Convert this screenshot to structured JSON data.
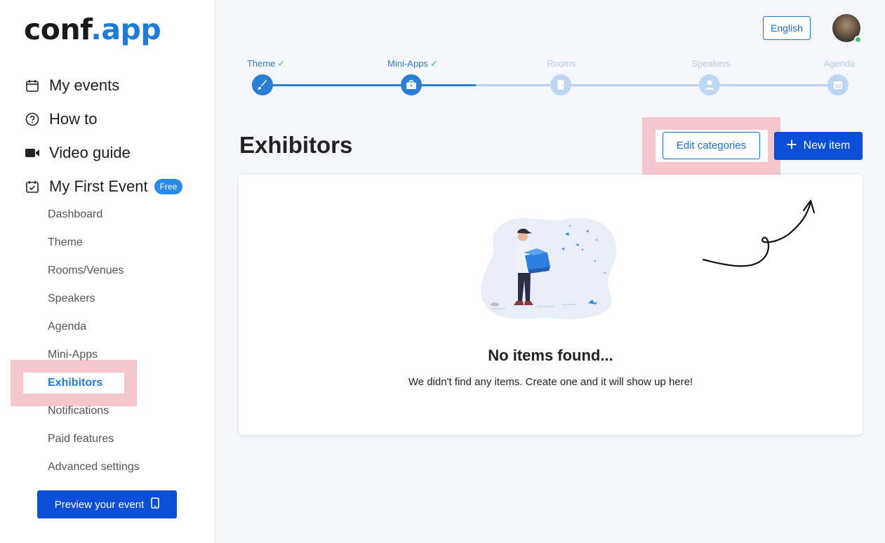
{
  "logo": {
    "main": "conf",
    "accent": ".app"
  },
  "sidebar": {
    "main_items": [
      {
        "label": "My events",
        "icon": "calendar-icon"
      },
      {
        "label": "How to",
        "icon": "question-circle-icon"
      },
      {
        "label": "Video guide",
        "icon": "video-camera-icon"
      },
      {
        "label": "My First Event",
        "icon": "calendar-check-icon",
        "badge": "Free"
      }
    ],
    "sub_items": [
      {
        "label": "Dashboard"
      },
      {
        "label": "Theme"
      },
      {
        "label": "Rooms/Venues"
      },
      {
        "label": "Speakers"
      },
      {
        "label": "Agenda"
      },
      {
        "label": "Mini-Apps"
      },
      {
        "label": "Exhibitors",
        "active": true
      },
      {
        "label": "Notifications"
      },
      {
        "label": "Paid features"
      },
      {
        "label": "Advanced settings"
      }
    ],
    "preview_label": "Preview your event"
  },
  "header": {
    "language": "English"
  },
  "stepper": {
    "steps": [
      {
        "label": "Theme",
        "done": true,
        "icon": "brush-icon"
      },
      {
        "label": "Mini-Apps",
        "done": true,
        "icon": "briefcase-icon"
      },
      {
        "label": "Rooms",
        "done": false,
        "icon": "door-icon"
      },
      {
        "label": "Speakers",
        "done": false,
        "icon": "user-icon"
      },
      {
        "label": "Agenda",
        "done": false,
        "icon": "calendar-grid-icon"
      }
    ],
    "check": "✓"
  },
  "main": {
    "title": "Exhibitors",
    "edit_categories_label": "Edit categories",
    "new_item_label": "New item",
    "empty_title": "No items found...",
    "empty_subtitle": "We didn't find any items. Create one and it will show up here!"
  },
  "colors": {
    "primary": "#0b4fd6",
    "accent": "#1e7bd8",
    "step_done": "#2a7fd4",
    "step_todo": "#bcd6f4",
    "highlight": "#f5c6cb"
  }
}
